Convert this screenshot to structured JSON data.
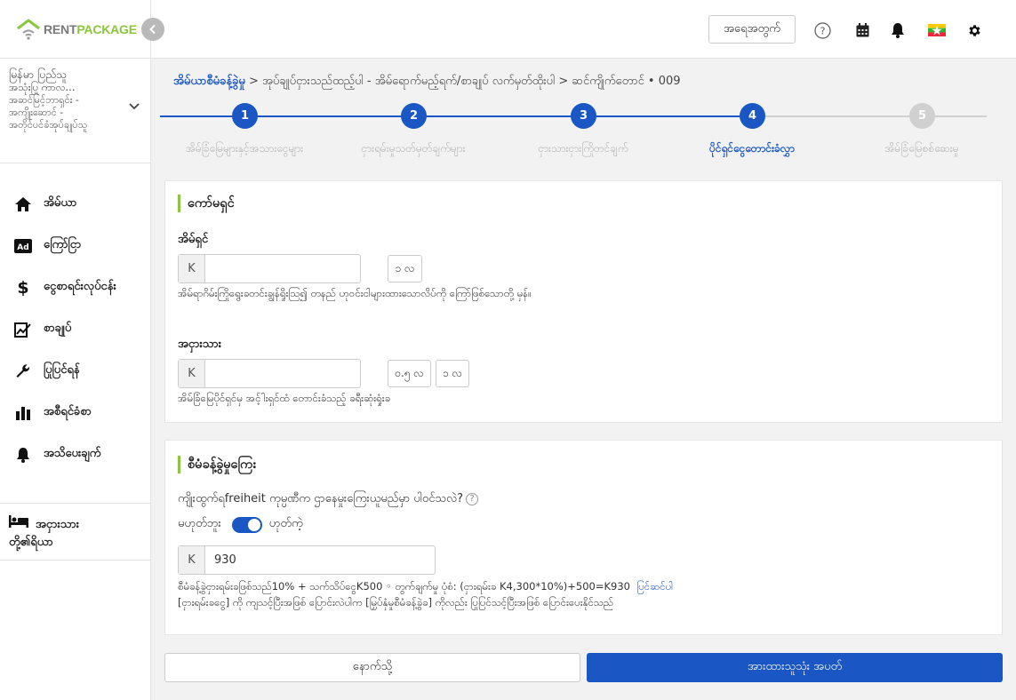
{
  "brand": {
    "rent": "RENT",
    "package": "PACKAGE"
  },
  "sidebar": {
    "collapse_icon": "chevron-left-icon",
    "building": {
      "line1": "မြန်မာ ပြည်သူ",
      "line2": "အသုံးပြု ကာလ...",
      "line3": "အဆင်မြင့်ဘာရှင်း -",
      "line4": "အကျိုးဆောင် -",
      "line5": "အတိုင်ပင်ခံအုပ်ချုပ်သူ"
    },
    "items": [
      {
        "label": "အိမ်ယာ",
        "icon": "home-icon"
      },
      {
        "label": "ကြော်ငြာ",
        "icon": "ad-icon"
      },
      {
        "label": "ငွေစာရင်းလုပ်ငန်း",
        "icon": "dollar-icon"
      },
      {
        "label": "စာချုပ်",
        "icon": "contract-icon"
      },
      {
        "label": "ပြုပြင်ရန်",
        "icon": "wrench-icon"
      },
      {
        "label": "အစီရင်ခံစာ",
        "icon": "bar-chart-icon"
      },
      {
        "label": "အသိပေးချက်",
        "icon": "bell-icon"
      }
    ],
    "tenant": {
      "line1": "အငှားသား",
      "line2": "တို့၏ရိယာ"
    }
  },
  "topbar": {
    "login_label": "အရေအတွက်",
    "icons": [
      "help-icon",
      "calendar-icon",
      "bell-icon",
      "myanmar-flag-icon",
      "gear-icon"
    ]
  },
  "breadcrumb": {
    "home": "အိမ်ယာစီမံခန့်ခွဲမှု",
    "rest": " > အုပ်ချုပ်ငှားသည်ထည့်ပါ - အိမ်ရောက်မည့်ရက်/စာချုပ် လက်မှတ်ထိုးပါ > ဆင်ကျိုက်တောင် • 009"
  },
  "stepper": {
    "steps": [
      {
        "num": "1",
        "label": "အိမ်ခြံမြေများနှင့်အသားငွေများ"
      },
      {
        "num": "2",
        "label": "ငှားရမ်းမှုသတ်မှတ်ချက်များ"
      },
      {
        "num": "3",
        "label": "ငှားသားငှားကြိုတင်ချက်"
      },
      {
        "num": "4",
        "label": "ပိုင်ရှင်ငွေတောင်းခံလွှာ"
      },
      {
        "num": "5",
        "label": "အိမ်ခြံမြေစစ်ဆေးမှု"
      }
    ],
    "active_index": 3,
    "colors": {
      "done": "#1a56c4",
      "active_label": "#1a56c4",
      "pending": "#d0d0d0",
      "label_muted": "#b5b5b5"
    }
  },
  "deposit_card": {
    "title": "ကော်မရှင်",
    "owner": {
      "label": "အိမ်ရှင်",
      "prefix": "K",
      "value": "",
      "chips": [
        "၁ လ"
      ],
      "hint": "အိမ်ရာဂိမ်းကြိုရွေးခတင်းချွန်ရှိုးသြ၍ တနည် ဟုဝင်းငါများထားသောလိပ်ကို ကြော်ဖြစ်သောတို့ မှန်။"
    },
    "tenant": {
      "label": "အငှားသား",
      "prefix": "K",
      "value": "",
      "chips": [
        "၀.၅ လ",
        "၁ လ"
      ],
      "hint": "အိမ်ခြံမြေပိုင်ရှင်မှ အင့်ါးရှင်ထံ တောင်းခံသည့် ခရီးဆုံးရှုံးခ"
    }
  },
  "mgmt_card": {
    "title": "စီမံခန့်ခွဲမှုကြေး",
    "question": "ကျိုးထွက်ရfreiheit ကုမ္ပဏီက ဌာနေမှုးကြေးယူမည်မှာ ပါဝင်သလဲ?",
    "toggle_no": "မဟုတ်ဘူး",
    "toggle_yes": "ဟုတ်ကဲ့",
    "toggle_on": true,
    "prefix": "K",
    "value": "930",
    "formula": "စီမံခန့်ခွဲငှားရမ်းခဖြစ်သည်10% + သက်သိပ်ငွေK500 ◦ တွက်ချက်မှု ပုံစံ: (ငှားရမ်းခ K4,300*10%)+500=K930",
    "formula_link": "ပြင်ဆင်ပါ",
    "note": "[ငှားရမ်းခငွေ] ကို ကျသင့်ပြီးအဖြစ် ပြောင်းလဲပါက [မြှပ်နှံမှုစီမံခန့်ခွဲခ] ကိုလည်း ပြုပြင်သင့်ပြီးအဖြစ် ပြောင်းပေးနိုင်သည်"
  },
  "actions": {
    "back": "နောက်သို့",
    "next": "အားထားသူသုံး အပတ်"
  }
}
